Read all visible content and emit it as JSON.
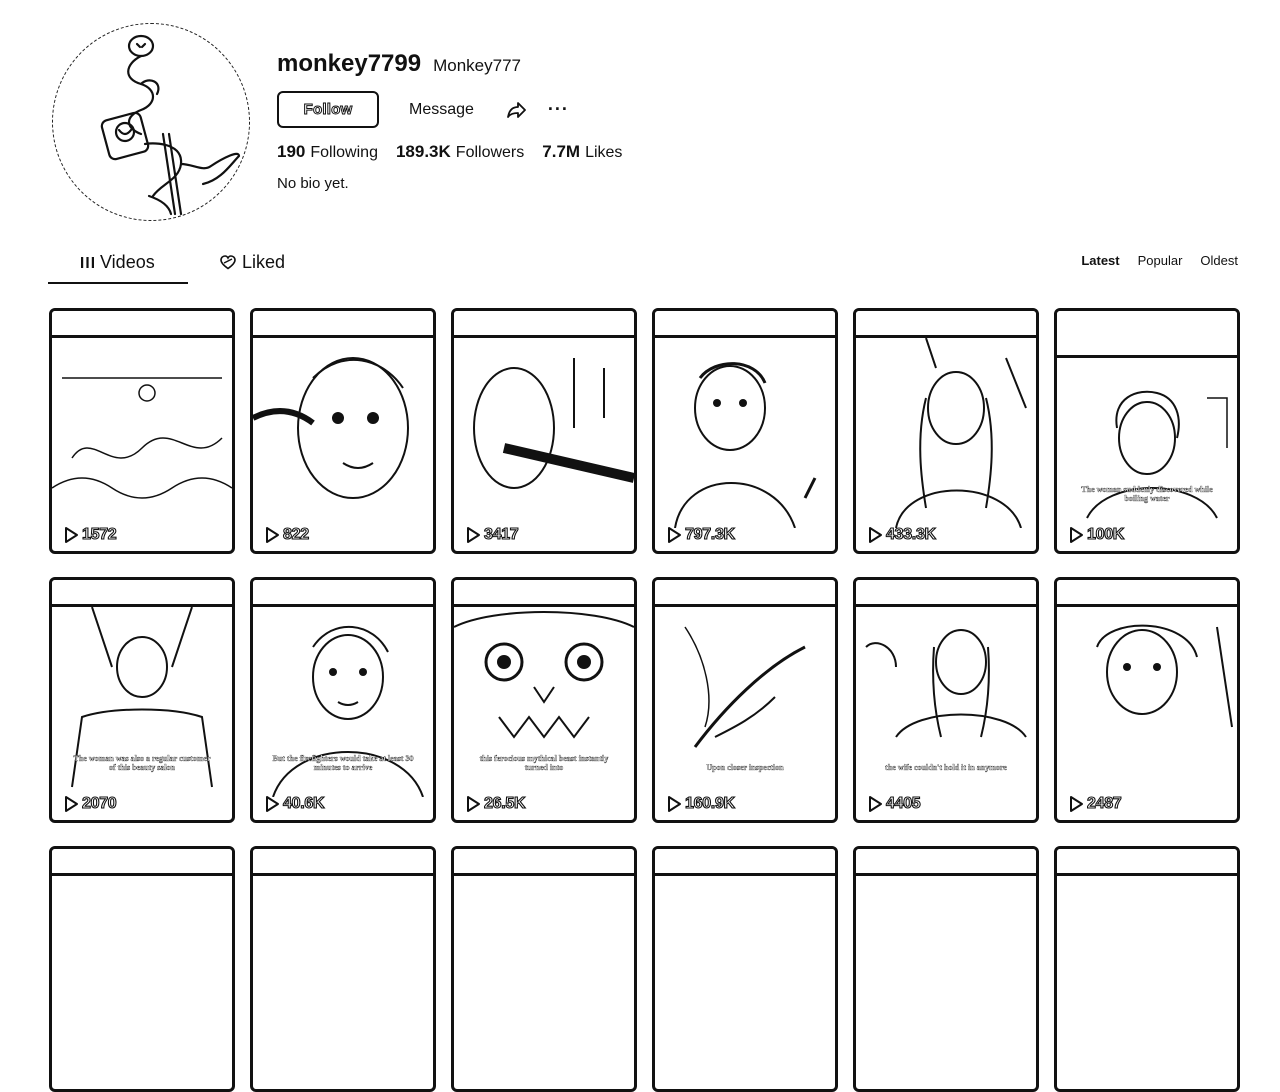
{
  "profile": {
    "username": "monkey7799",
    "nickname": "Monkey777",
    "follow_label": "Follow",
    "message_label": "Message",
    "more_label": "···",
    "stats": [
      {
        "value": "190",
        "label": "Following"
      },
      {
        "value": "189.3K",
        "label": "Followers"
      },
      {
        "value": "7.7M",
        "label": "Likes"
      }
    ],
    "bio": "No bio yet."
  },
  "tabs": [
    {
      "label": "Videos",
      "icon": "grid-bars-icon"
    },
    {
      "label": "Liked",
      "icon": "heart-icon"
    }
  ],
  "sort": [
    "Latest",
    "Popular",
    "Oldest"
  ],
  "videos": [
    {
      "views": "1572",
      "caption": ""
    },
    {
      "views": "822",
      "caption": ""
    },
    {
      "views": "3417",
      "caption": ""
    },
    {
      "views": "797.3K",
      "caption": ""
    },
    {
      "views": "433.3K",
      "caption": ""
    },
    {
      "views": "100K",
      "caption": "The woman suddenly discovered while boiling water"
    },
    {
      "views": "2070",
      "caption": "The woman was also a regular customer of this beauty salon"
    },
    {
      "views": "40.6K",
      "caption": "But the firefighters would take at least 30 minutes to arrive"
    },
    {
      "views": "26.5K",
      "caption": "this ferocious mythical beast instantly turned into"
    },
    {
      "views": "160.9K",
      "caption": "Upon closer inspection"
    },
    {
      "views": "4405",
      "caption": "the wife couldn't hold it in anymore"
    },
    {
      "views": "2487",
      "caption": ""
    },
    {
      "views": "",
      "caption": ""
    },
    {
      "views": "",
      "caption": ""
    },
    {
      "views": "",
      "caption": ""
    },
    {
      "views": "",
      "caption": ""
    },
    {
      "views": "",
      "caption": ""
    },
    {
      "views": "",
      "caption": ""
    }
  ]
}
